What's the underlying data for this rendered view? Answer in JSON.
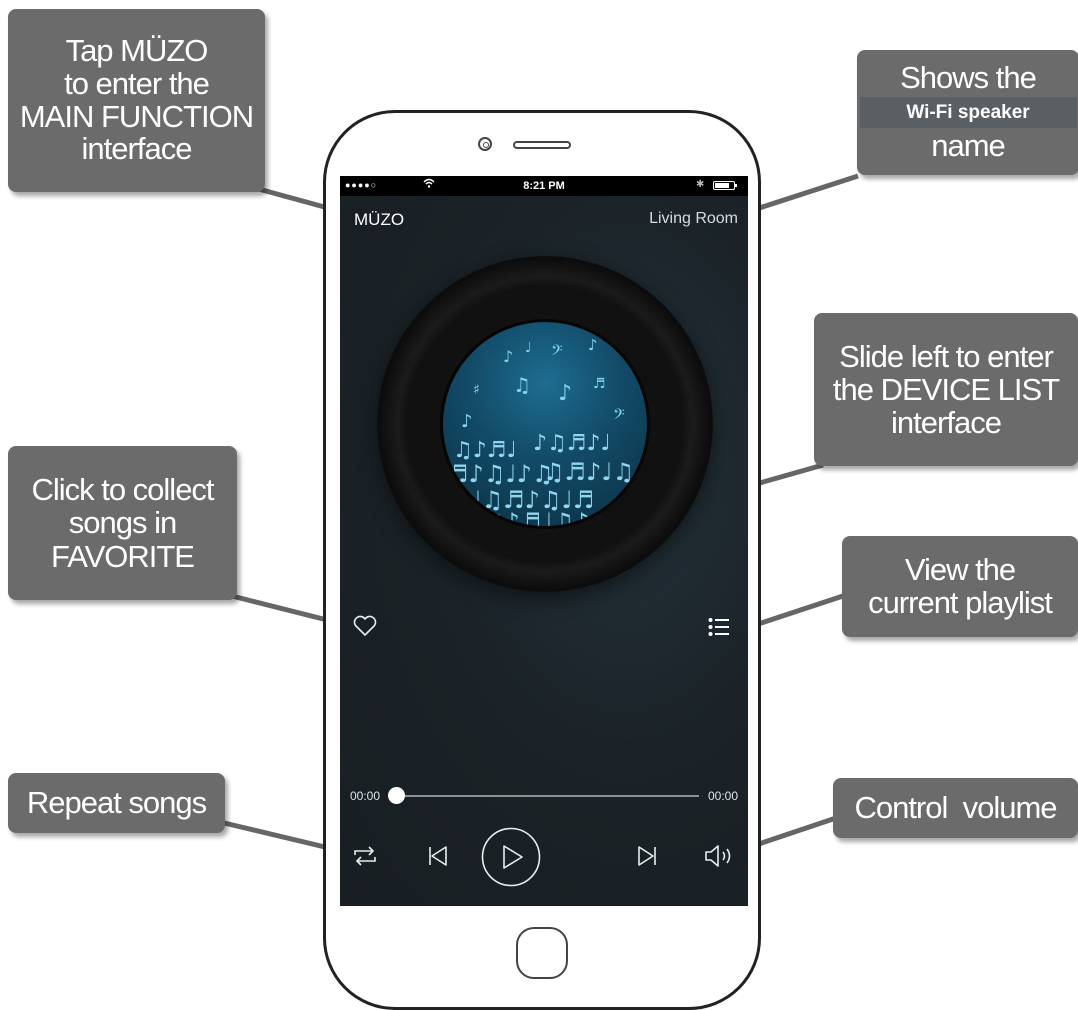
{
  "status_bar": {
    "signal": "●●●●○",
    "time": "8:21 PM"
  },
  "header": {
    "brand": "MÜZO",
    "speaker_name": "Living Room"
  },
  "player": {
    "elapsed": "00:00",
    "total": "00:00",
    "progress": 0
  },
  "callouts": {
    "main_function": [
      "Tap MÜZO",
      "to enter the",
      "MAIN FUNCTION",
      "interface"
    ],
    "speaker_name": {
      "line1": "Shows the",
      "highlight": "Wi-Fi speaker",
      "line3": "name"
    },
    "device_list": [
      "Slide left to enter",
      "the DEVICE LIST",
      "interface"
    ],
    "favorite": [
      "Click to collect",
      "songs in",
      "FAVORITE"
    ],
    "playlist": [
      "View the",
      "current playlist"
    ],
    "repeat": "Repeat songs",
    "volume": "Control  volume"
  },
  "colors": {
    "callout_bg": "#6b6b6b",
    "screen_bg": "#1b2328",
    "record_label": "#1e6d92"
  },
  "icons": [
    "wifi-icon",
    "bluetooth-icon",
    "battery-icon",
    "heart-icon",
    "playlist-icon",
    "repeat-icon",
    "previous-icon",
    "play-icon",
    "next-icon",
    "volume-icon",
    "camera-icon",
    "home-button-icon"
  ]
}
